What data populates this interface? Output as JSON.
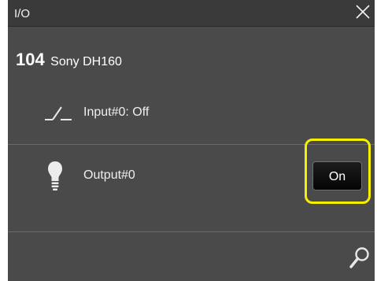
{
  "window": {
    "title": "I/O"
  },
  "device": {
    "id": "104",
    "name": "Sony DH160"
  },
  "input": {
    "label": "Input#0: Off"
  },
  "output": {
    "label": "Output#0",
    "button_label": "On"
  },
  "icons": {
    "close": "close-icon",
    "input": "switch-off-icon",
    "output": "light-bulb-icon",
    "search": "search-icon"
  },
  "colors": {
    "panel_bg": "#4a4a4a",
    "titlebar_bg": "#3a3a3a",
    "highlight": "#f4f000",
    "button_bg": "#111111"
  }
}
